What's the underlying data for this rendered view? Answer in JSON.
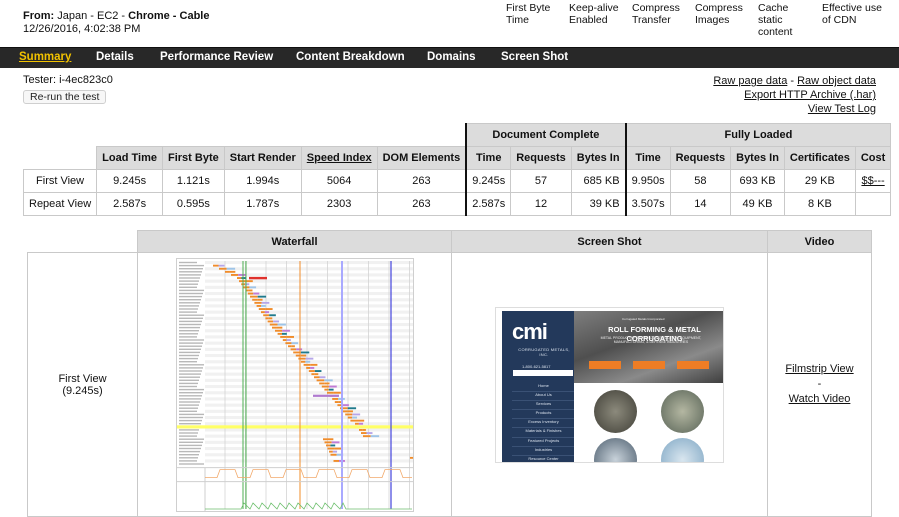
{
  "header": {
    "from_label": "From:",
    "from_location": "Japan - EC2 -",
    "from_browser": "Chrome - Cable",
    "datetime": "12/26/2016, 4:02:38 PM",
    "grades": [
      {
        "label": "First Byte Time"
      },
      {
        "label": "Keep-alive Enabled"
      },
      {
        "label": "Compress Transfer"
      },
      {
        "label": "Compress Images"
      },
      {
        "label": "Cache static content"
      },
      {
        "label": "Effective use of CDN"
      }
    ]
  },
  "nav": {
    "items": [
      {
        "label": "Summary",
        "active": true
      },
      {
        "label": "Details"
      },
      {
        "label": "Performance Review"
      },
      {
        "label": "Content Breakdown"
      },
      {
        "label": "Domains"
      },
      {
        "label": "Screen Shot"
      }
    ]
  },
  "tester": {
    "label": "Tester: i-4ec823c0",
    "rerun_button": "Re-run the test"
  },
  "links": {
    "raw_page_data": "Raw page data",
    "separator": " - ",
    "raw_object_data": "Raw object data",
    "export_har": "Export HTTP Archive (.har)",
    "view_test_log": "View Test Log"
  },
  "results": {
    "group_headers": {
      "document_complete": "Document Complete",
      "fully_loaded": "Fully Loaded"
    },
    "columns": {
      "load_time": "Load Time",
      "first_byte": "First Byte",
      "start_render": "Start Render",
      "speed_index": "Speed Index",
      "dom_elements": "DOM Elements",
      "dc_time": "Time",
      "dc_requests": "Requests",
      "dc_bytes": "Bytes In",
      "fl_time": "Time",
      "fl_requests": "Requests",
      "fl_bytes": "Bytes In",
      "certificates": "Certificates",
      "cost": "Cost"
    },
    "rows": [
      {
        "label": "First View",
        "load_time": "9.245s",
        "first_byte": "1.121s",
        "start_render": "1.994s",
        "speed_index": "5064",
        "dom_elements": "263",
        "dc_time": "9.245s",
        "dc_requests": "57",
        "dc_bytes": "685 KB",
        "fl_time": "9.950s",
        "fl_requests": "58",
        "fl_bytes": "693 KB",
        "certificates": "29 KB",
        "cost": "$$---"
      },
      {
        "label": "Repeat View",
        "load_time": "2.587s",
        "first_byte": "0.595s",
        "start_render": "1.787s",
        "speed_index": "2303",
        "dom_elements": "263",
        "dc_time": "2.587s",
        "dc_requests": "12",
        "dc_bytes": "39 KB",
        "fl_time": "3.507s",
        "fl_requests": "14",
        "fl_bytes": "49 KB",
        "certificates": "8 KB",
        "cost": ""
      }
    ]
  },
  "lower": {
    "headers": {
      "waterfall": "Waterfall",
      "screen_shot": "Screen Shot",
      "video": "Video"
    },
    "row_label": "First View",
    "row_time": "(9.245s)",
    "filmstrip_link": "Filmstrip View",
    "video_separator": "-",
    "watch_video_link": "Watch Video"
  },
  "screenshot_thumb": {
    "logo": "cmi",
    "logo_sub": "CORRUGATED METALS, INC.",
    "phone": "1-800-621-5817",
    "hero_small": "Corrugated Metals Incorporated",
    "hero_title": "ROLL FORMING & METAL CORRUGATING",
    "hero_sub": "METAL PRODUCTS FOR THE CONSTRUCTION, EQUIPMENT, MANUFACTURING, & DEFENSE INDUSTRIES",
    "menu": [
      "Home",
      "About Us",
      "Services",
      "Products",
      "Excess Inventory",
      "Materials & Finishes",
      "Featured Projects",
      "Industries",
      "Resource Center"
    ]
  },
  "colors": {
    "nav_bg": "#282828",
    "nav_active": "#f2c200",
    "header_cell_bg": "#dcdcdc",
    "start_render_line": "#4caf50",
    "doc_complete_line": "#f08c2a",
    "onload_line": "#a9a9ff",
    "fully_loaded_line": "#4444dd"
  }
}
